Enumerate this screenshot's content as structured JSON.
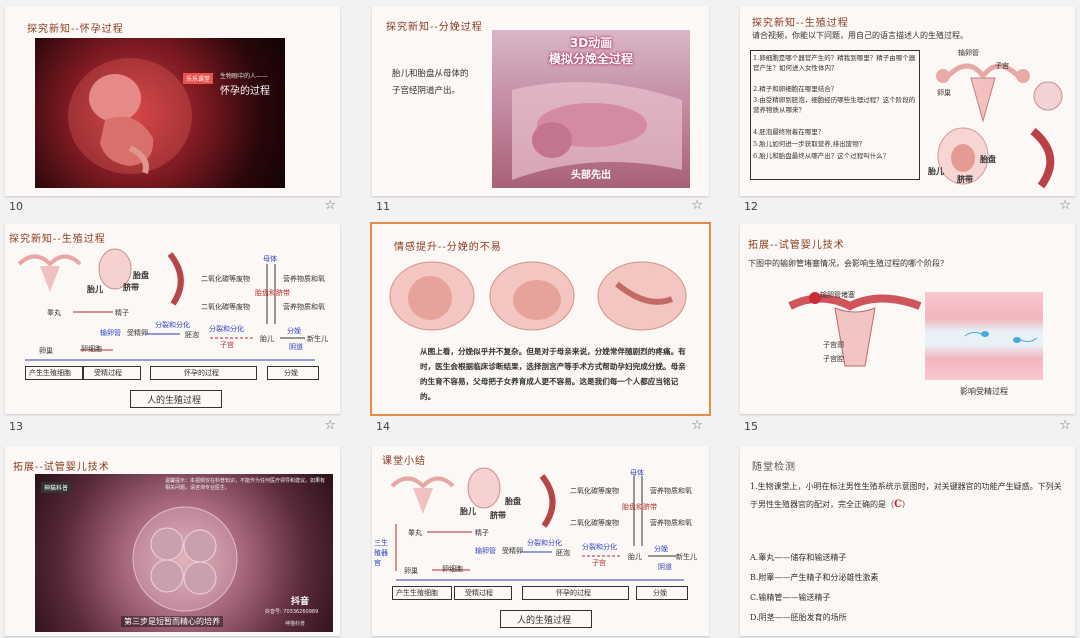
{
  "slides": [
    {
      "num": "10",
      "header": "探究新知--怀孕过程",
      "video_channel": "乐乐课堂",
      "video_sub": "生物眼中的人——",
      "video_title": "怀孕的过程"
    },
    {
      "num": "11",
      "header": "探究新知--分娩过程",
      "title_line1": "3D动画",
      "title_line2": "模拟分娩全过程",
      "body": "胎儿和胎盘从母体的子宫经阴道产出。",
      "caption": "头部先出"
    },
    {
      "num": "12",
      "header": "探究新知--生殖过程",
      "intro": "请合视频，你能以下问题，用自己的语言描述人的生殖过程。",
      "questions": [
        "1.卵细胞是哪个器官产生的？精我到哪里？精子由哪个器官产生？如何进入女性体内？",
        "2.精子和卵细胞在哪里结合？",
        "3.由受精卵到胚泡，细胞经历哪些生理过程？这个阶段的营养物质从哪来？",
        "4.胚泡最终附着在哪里？",
        "5.胎儿如何进一步获取营养,排出废物？",
        "6.胎儿和胎盘最终从哪产出？这个过程叫什么？"
      ],
      "labels": {
        "fallopian": "输卵管",
        "ovary": "卵巢",
        "uterus": "子宫",
        "fetus": "胎儿",
        "placenta": "胎盘",
        "cord": "脐带"
      }
    },
    {
      "num": "13",
      "header": "探究新知--生殖过程",
      "caption": "人的生殖过程",
      "labels": {
        "fetus": "胎儿",
        "placenta": "胎盘",
        "cord": "脐带",
        "mother": "母体",
        "co2": "二氧化碳等废物",
        "nutrients": "营养物质和氧",
        "nutrients2": "营养物质和氧",
        "placenta_cord": "胎盘和脐带",
        "testis": "睾丸",
        "sperm": "精子",
        "ovary": "卵巢",
        "egg": "卵细胞",
        "tube": "输卵管",
        "zygote": "受精卵",
        "divide1": "分裂和分化",
        "divide2": "分裂和分化",
        "blastocyst": "胚泡",
        "uterus": "子宫",
        "fetus2": "胎儿",
        "newborn": "新生儿",
        "delivery": "分娩",
        "vagina": "阴道"
      },
      "stages": [
        "产生生殖细胞",
        "受精过程",
        "怀孕的过程",
        "分娩"
      ]
    },
    {
      "num": "14",
      "header": "情感提升--分娩的不易",
      "body": "从图上看，分娩似乎并不复杂。但是对于母亲来说，分娩常伴随剧烈的疼痛。有时，医生会根据临床诊断结果，选择剖宫产等手术方式帮助孕妇完成分娩。母亲的生育不容易，父母把子女养育成人更不容易。这是我们每一个人都应当铭记的。"
    },
    {
      "num": "15",
      "header": "拓展--试管婴儿技术",
      "question": "下图中的输卵管堵塞情况，会影响生殖过程的哪个阶段？",
      "labels": {
        "blocked": "输卵管堵塞",
        "uterus": "子宫腔",
        "cervix": "子宫颈"
      },
      "caption": "影响受精过程"
    },
    {
      "num": "",
      "header": "拓展--试管婴儿技术",
      "notice": "温馨提示：本视频仅在科普知识，不能作为任何医疗领导和建议。如果有相关问题，请咨询专业医生。",
      "channel": "神猫科普",
      "douyin": "抖音",
      "douyin_id": "抖音号: 70336260989",
      "subtitle": "第三步是短暂而精心的培养",
      "watermark": "神猫科普"
    },
    {
      "num": "",
      "header": "课堂小结",
      "caption": "人的生殖过程",
      "labels": {
        "organs": "三生殖器官",
        "fetus": "胎儿",
        "placenta": "胎盘",
        "cord": "脐带",
        "mother": "母体",
        "co2": "二氧化碳等废物",
        "nutrients": "营养物质和氧",
        "nutrients2": "营养物质和氧",
        "placenta_cord": "胎盘和脐带",
        "testis": "睾丸",
        "sperm": "精子",
        "ovary": "卵巢",
        "egg": "卵细胞",
        "tube": "输卵管",
        "zygote": "受精卵",
        "divide1": "分裂和分化",
        "divide2": "分裂和分化",
        "blastocyst": "胚泡",
        "uterus": "子宫",
        "fetus2": "胎儿",
        "newborn": "新生儿",
        "delivery": "分娩",
        "vagina": "阴道"
      },
      "stages": [
        "产生生殖细胞",
        "受精过程",
        "怀孕的过程",
        "分娩"
      ]
    },
    {
      "num": "",
      "header": "随堂检测",
      "question": "1.生物课堂上，小明在标注男性生殖系统示意图时，对关键器官的功能产生疑惑。下列关于男性生殖器官的配对，完全正确的是（",
      "answer": "C",
      "close": "）",
      "options": [
        "A.睾丸——储存和输送精子",
        "B.附睾——产生精子和分泌雄性激素",
        "C.输精管——输送精子",
        "D.阴茎——胚胎发育的场所"
      ]
    }
  ]
}
